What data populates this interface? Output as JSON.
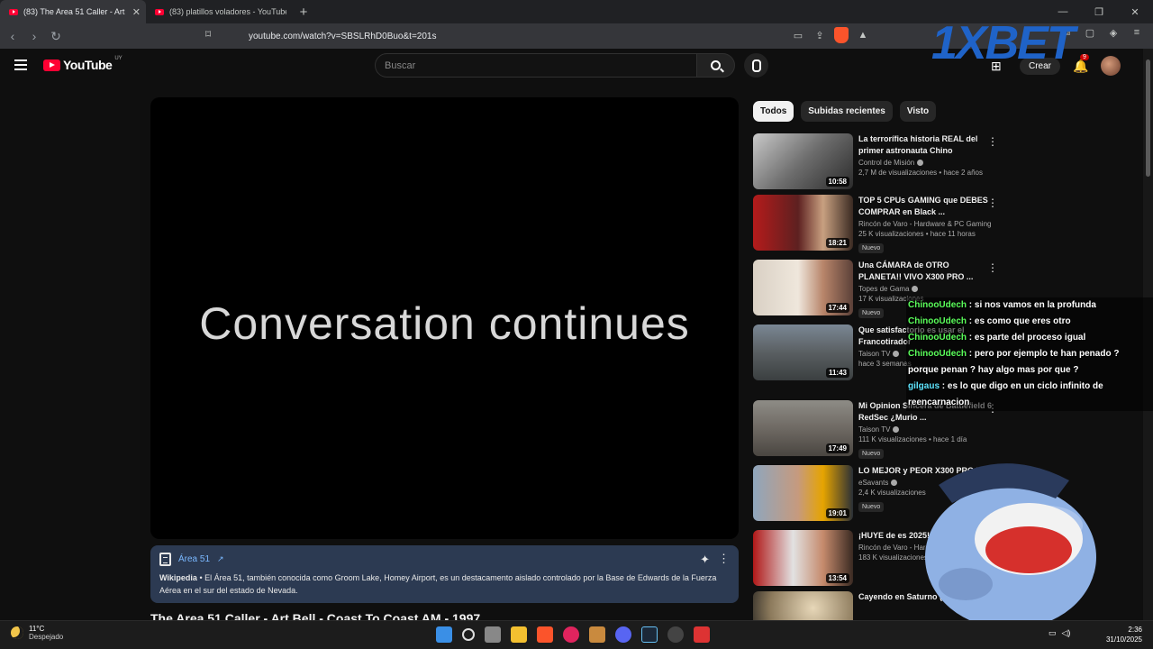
{
  "browser": {
    "tabs": [
      {
        "title": "(83) The Area 51 Caller - Art Bell",
        "active": true
      },
      {
        "title": "(83) platillos voladores - YouTube",
        "active": false
      }
    ],
    "url": "youtube.com/watch?v=SBSLRhD0Buo&t=201s"
  },
  "header": {
    "logo_text": "YouTube",
    "region": "UY",
    "search_placeholder": "Buscar",
    "create_label": "Crear",
    "notifications_count": "9"
  },
  "overlay_ad": {
    "text": "1XBET"
  },
  "player": {
    "caption": "Conversation continues"
  },
  "info_card": {
    "topic": "Área 51",
    "source": "Wikipedia",
    "description": " • El Área 51, también conocida como Groom Lake, Homey Airport, es un destacamento aislado controlado por la Base de Edwards de la Fuerza Aérea en el sur del estado de Nevada."
  },
  "video_title": "The Area 51 Caller - Art Bell - Coast To Coast AM - 1997",
  "chips": [
    "Todos",
    "Subidas recientes",
    "Visto"
  ],
  "recommendations": [
    {
      "title": "La terrorífica historia REAL del primer astronauta Chino",
      "channel": "Control de Misión",
      "stats": "2,7 M de visualizaciones • hace 2 años",
      "duration": "10:58",
      "badge": ""
    },
    {
      "title": "TOP 5 CPUs GAMING que DEBES COMPRAR en Black ...",
      "channel": "Rincón de Varo - Hardware & PC Gaming",
      "stats": "25 K visualizaciones • hace 11 horas",
      "duration": "18:21",
      "badge": "Nuevo"
    },
    {
      "title": "Una CÁMARA de OTRO PLANETA!! VIVO X300 PRO ...",
      "channel": "Topes de Gama",
      "stats": "17 K visualizaciones",
      "duration": "17:44",
      "badge": "Nuevo"
    },
    {
      "title": "Que satisfactorio es usar el Francotirador",
      "channel": "Taison TV",
      "stats": "hace 3 semanas",
      "duration": "11:43",
      "badge": ""
    },
    {
      "title": "Mi Opinion Sincera de Battlefield 6 RedSec ¿Murio ...",
      "channel": "Taison TV",
      "stats": "111 K visualizaciones • hace 1 día",
      "duration": "17:49",
      "badge": "Nuevo"
    },
    {
      "title": "LO MEJOR y PEOR X300 PRO | Re",
      "channel": "eSavants",
      "stats": "2,4 K visualizaciones",
      "duration": "19:01",
      "badge": "Nuevo"
    },
    {
      "title": "¡HUYE de es 2025! | TOP Mejor",
      "channel": "Rincón de Varo - Hard",
      "stats": "183 K visualizaciones",
      "duration": "13:54",
      "badge": ""
    },
    {
      "title": "Cayendo en Saturno (Simulación)",
      "channel": "",
      "stats": "",
      "duration": "",
      "badge": ""
    }
  ],
  "chat": [
    {
      "user": "ChinooUdech",
      "text": " : si nos vamos en la profunda"
    },
    {
      "user": "ChinooUdech",
      "text": " : es como que eres otro"
    },
    {
      "user": "ChinooUdech",
      "text": " : es parte del proceso igual"
    },
    {
      "user": "ChinooUdech",
      "text": " : pero por ejemplo te han penado ? porque penan ? hay algo mas por que ?"
    },
    {
      "user": "gilgaus",
      "text": " : es lo que digo en un ciclo infinito de reencarnacion"
    }
  ],
  "taskbar": {
    "temperature": "11°C",
    "weather": "Despejado",
    "time": "2:36",
    "date": "31/10/2025"
  }
}
